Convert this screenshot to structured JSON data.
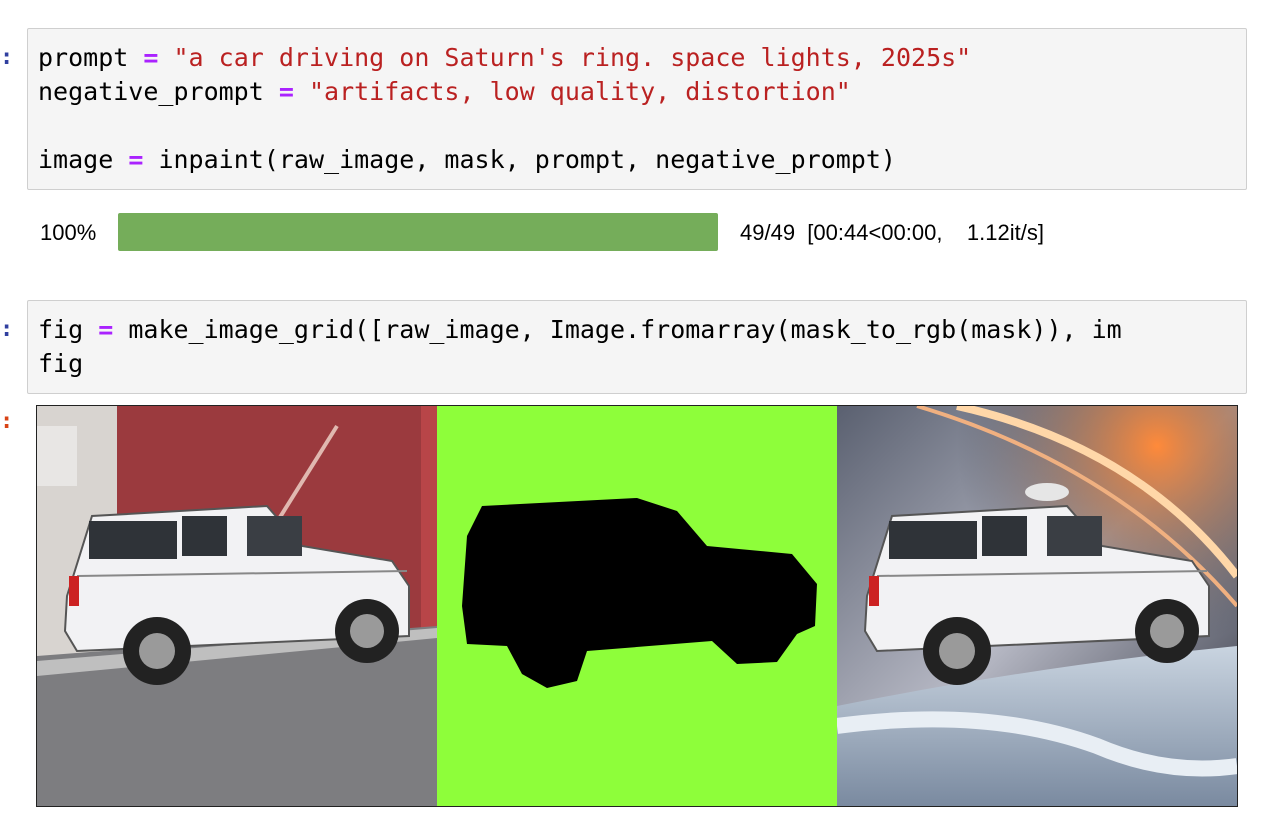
{
  "cells": {
    "inpaint_cell": {
      "prompt_marker": ":",
      "line1": {
        "var": "prompt",
        "op": "=",
        "str": "\"a car driving on Saturn's ring. space lights, 2025s\""
      },
      "line2": {
        "var": "negative_prompt",
        "op": "=",
        "str": "\"artifacts, low quality, distortion\""
      },
      "line4": {
        "var": "image",
        "op": "=",
        "rest": "inpaint(raw_image, mask, prompt, negative_prompt)"
      }
    },
    "progress": {
      "percent_label": "100%",
      "fraction": 1.0,
      "counts": "49/49  [00:44<00:00,    1.12it/s]",
      "bar_color": "#75ad5a"
    },
    "grid_cell": {
      "prompt_marker": ":",
      "line1": {
        "var": "fig",
        "op": "=",
        "rest": "make_image_grid([raw_image, Image.fromarray(mask_to_rgb(mask)), im"
      },
      "line2": {
        "var": "fig"
      }
    },
    "output": {
      "prompt_marker": ":",
      "panels": [
        "raw-image",
        "mask-image",
        "inpainted-image"
      ],
      "mask_color": "#8efe3a"
    }
  }
}
